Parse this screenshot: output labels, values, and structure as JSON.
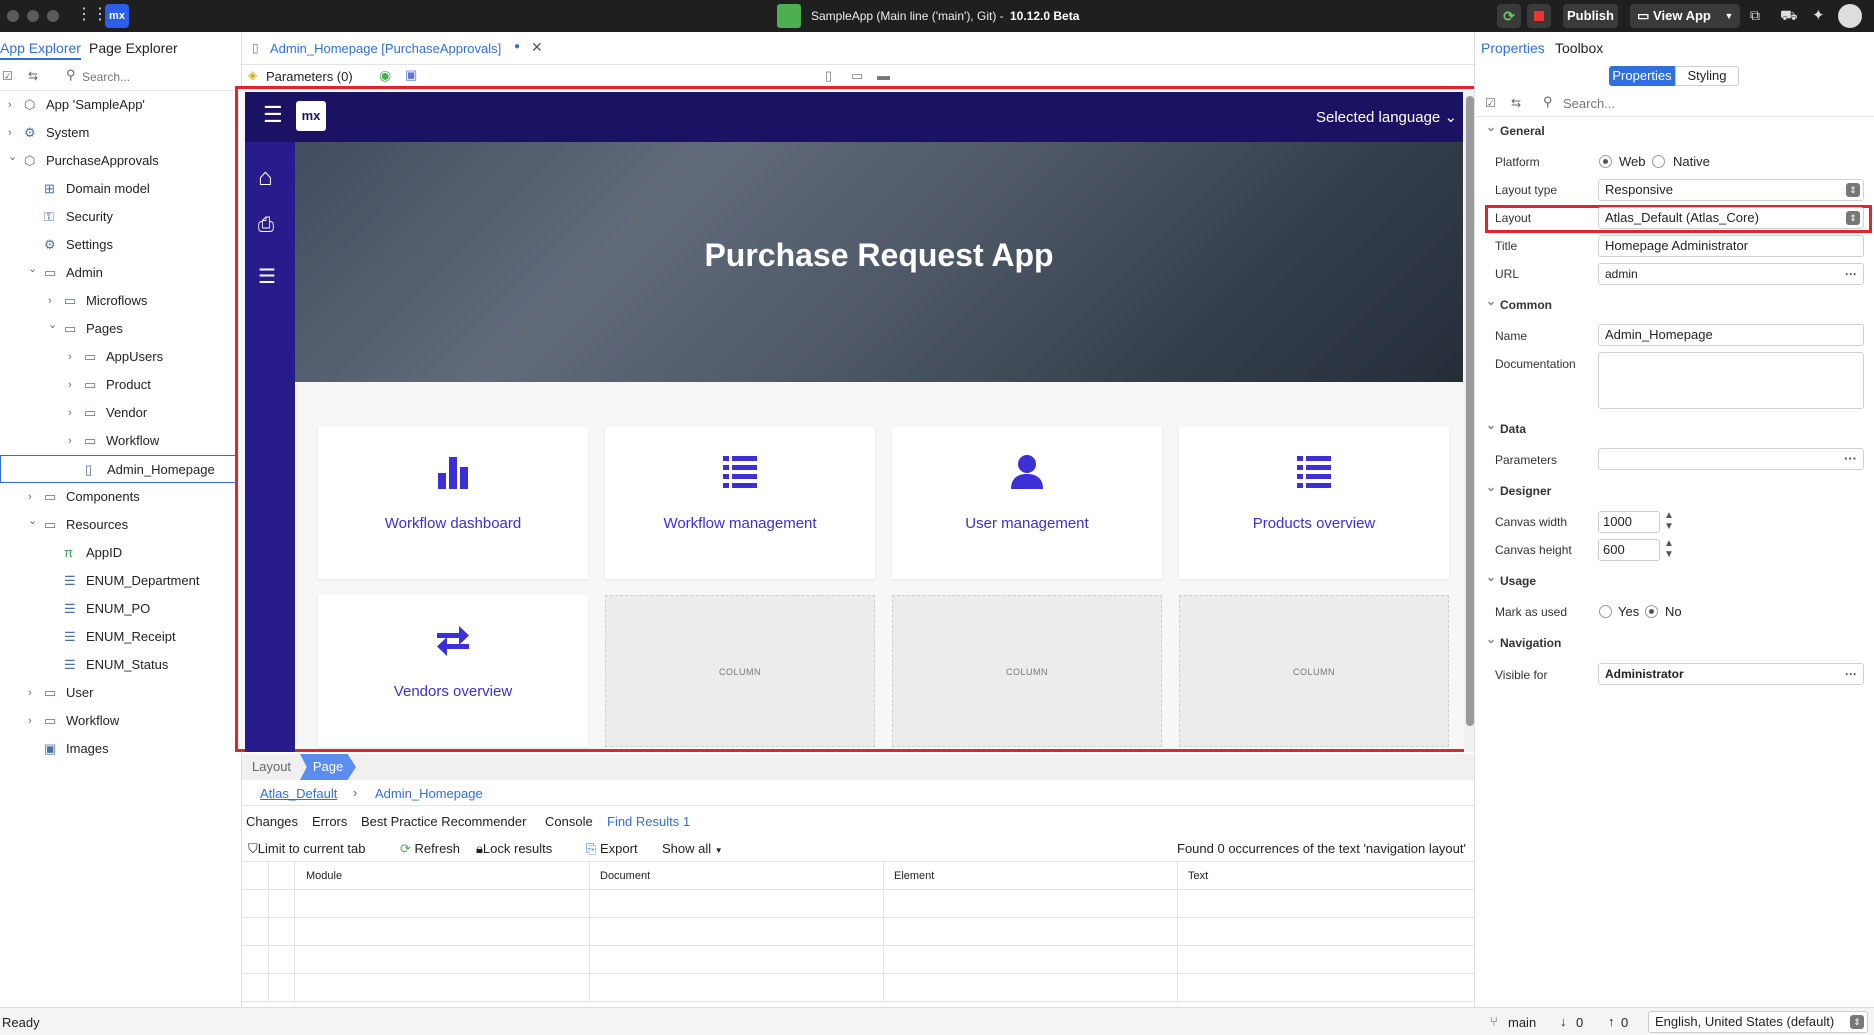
{
  "titlebar": {
    "app_title": "SampleApp (Main line ('main'), Git) -",
    "version": "10.12.0 Beta",
    "publish_label": "Publish",
    "view_app_label": "View App",
    "logo": "mx"
  },
  "left_panel": {
    "tabs": [
      "App Explorer",
      "Page Explorer"
    ],
    "search_placeholder": "Search...",
    "tree": [
      {
        "label": "App 'SampleApp'",
        "icon": "box-icon",
        "chev": "right"
      },
      {
        "label": "System",
        "icon": "gear-icon",
        "chev": "right"
      },
      {
        "label": "PurchaseApprovals",
        "icon": "box-icon",
        "chev": "down"
      },
      {
        "label": "Domain model",
        "icon": "domain-icon",
        "chev": ""
      },
      {
        "label": "Security",
        "icon": "key-icon",
        "chev": ""
      },
      {
        "label": "Settings",
        "icon": "gear-icon",
        "chev": ""
      },
      {
        "label": "Admin",
        "icon": "folder-icon",
        "chev": "down"
      },
      {
        "label": "Microflows",
        "icon": "folder-icon",
        "chev": "right"
      },
      {
        "label": "Pages",
        "icon": "folder-icon",
        "chev": "down"
      },
      {
        "label": "AppUsers",
        "icon": "folder-icon",
        "chev": "right"
      },
      {
        "label": "Product",
        "icon": "folder-icon",
        "chev": "right"
      },
      {
        "label": "Vendor",
        "icon": "folder-icon",
        "chev": "right"
      },
      {
        "label": "Workflow",
        "icon": "folder-icon",
        "chev": "right"
      },
      {
        "label": "Admin_Homepage",
        "icon": "page-icon",
        "chev": ""
      },
      {
        "label": "Components",
        "icon": "folder-icon",
        "chev": "right"
      },
      {
        "label": "Resources",
        "icon": "folder-icon",
        "chev": "down"
      },
      {
        "label": "AppID",
        "icon": "constant-icon",
        "chev": ""
      },
      {
        "label": "ENUM_Department",
        "icon": "enum-icon",
        "chev": ""
      },
      {
        "label": "ENUM_PO",
        "icon": "enum-icon",
        "chev": ""
      },
      {
        "label": "ENUM_Receipt",
        "icon": "enum-icon",
        "chev": ""
      },
      {
        "label": "ENUM_Status",
        "icon": "enum-icon",
        "chev": ""
      },
      {
        "label": "User",
        "icon": "folder-icon",
        "chev": "right"
      },
      {
        "label": "Workflow",
        "icon": "folder-icon",
        "chev": "right"
      },
      {
        "label": "Images",
        "icon": "images-icon",
        "chev": ""
      }
    ]
  },
  "editor": {
    "tab_label": "Admin_Homepage [PurchaseApprovals]",
    "params_label": "Parameters (0)",
    "canvas": {
      "logo": "mx",
      "language_label": "Selected language",
      "hero_title": "Purchase Request App",
      "cards": [
        {
          "label": "Workflow dashboard",
          "icon": "bar-chart-icon"
        },
        {
          "label": "Workflow management",
          "icon": "list-icon"
        },
        {
          "label": "User management",
          "icon": "user-icon"
        },
        {
          "label": "Products overview",
          "icon": "list-icon"
        },
        {
          "label": "Vendors overview",
          "icon": "exchange-icon"
        }
      ],
      "column_placeholder": "COLUMN"
    },
    "bottom_tabs": [
      "Layout",
      "Page"
    ],
    "breadcrumb": [
      "Atlas_Default",
      "Admin_Homepage"
    ]
  },
  "results": {
    "tabs": [
      "Changes",
      "Errors",
      "Best Practice Recommender",
      "Console",
      "Find Results 1"
    ],
    "toolbar": {
      "limit": "Limit to current tab",
      "refresh": "Refresh",
      "lock": "Lock results",
      "export": "Export",
      "show_all": "Show all",
      "status": "Found 0 occurrences of the text 'navigation layout'"
    },
    "columns": [
      "Module",
      "Document",
      "Element",
      "Text"
    ]
  },
  "properties": {
    "tabs": [
      "Properties",
      "Toolbox"
    ],
    "subtabs": [
      "Properties",
      "Styling"
    ],
    "search_placeholder": "Search...",
    "general": {
      "heading": "General",
      "platform_label": "Platform",
      "platform_web": "Web",
      "platform_native": "Native",
      "layout_type_label": "Layout type",
      "layout_type_value": "Responsive",
      "layout_label": "Layout",
      "layout_value": "Atlas_Default (Atlas_Core)",
      "title_label": "Title",
      "title_value": "Homepage Administrator",
      "url_label": "URL",
      "url_value": "admin"
    },
    "common": {
      "heading": "Common",
      "name_label": "Name",
      "name_value": "Admin_Homepage",
      "doc_label": "Documentation"
    },
    "data": {
      "heading": "Data",
      "params_label": "Parameters"
    },
    "designer": {
      "heading": "Designer",
      "width_label": "Canvas width",
      "width_value": "1000",
      "height_label": "Canvas height",
      "height_value": "600"
    },
    "usage": {
      "heading": "Usage",
      "mark_label": "Mark as used",
      "yes": "Yes",
      "no": "No"
    },
    "navigation": {
      "heading": "Navigation",
      "visible_label": "Visible for",
      "visible_value": "Administrator"
    }
  },
  "statusbar": {
    "left": "Ready",
    "branch": "main",
    "down_count": "0",
    "up_count": "0",
    "language": "English, United States (default)"
  },
  "colors": {
    "accent": "#3b2fd6",
    "nav_dark": "#1b1263",
    "highlight_red": "#e1252b",
    "link_blue": "#2f6fe0"
  }
}
